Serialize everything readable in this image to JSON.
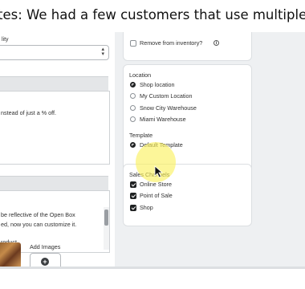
{
  "caption": "tes: We had a few customers that use multiple templates",
  "left": {
    "field_label": "lity",
    "desc_text": "nstead of just a % off.",
    "notes_lines": [
      "be reflective of the Open Box",
      "ed, now you can customize it.",
      "roduct."
    ],
    "add_images_label": "Add Images"
  },
  "inventory": {
    "remove_label": "Remove from inventory?"
  },
  "location": {
    "title": "Location",
    "options": [
      "Shop location",
      "My Custom Location",
      "Snow City Warehouse",
      "Miami Warehouse"
    ],
    "selected": "Shop location"
  },
  "template": {
    "title": "Template",
    "options": [
      "Default Template"
    ],
    "selected": "Default Template"
  },
  "sales_channels": {
    "title": "Sales Channels",
    "options": [
      "Online Store",
      "Point of Sale",
      "Shop"
    ],
    "checked": [
      true,
      true,
      true
    ]
  },
  "icons": {
    "info": "info-icon",
    "select_arrows": "up-down-arrows-icon",
    "add": "plus-circle-icon",
    "cursor": "mouse-pointer-icon"
  },
  "colors": {
    "highlight": "#faf05a",
    "checked": "#202223",
    "background": "#eef0f2"
  }
}
